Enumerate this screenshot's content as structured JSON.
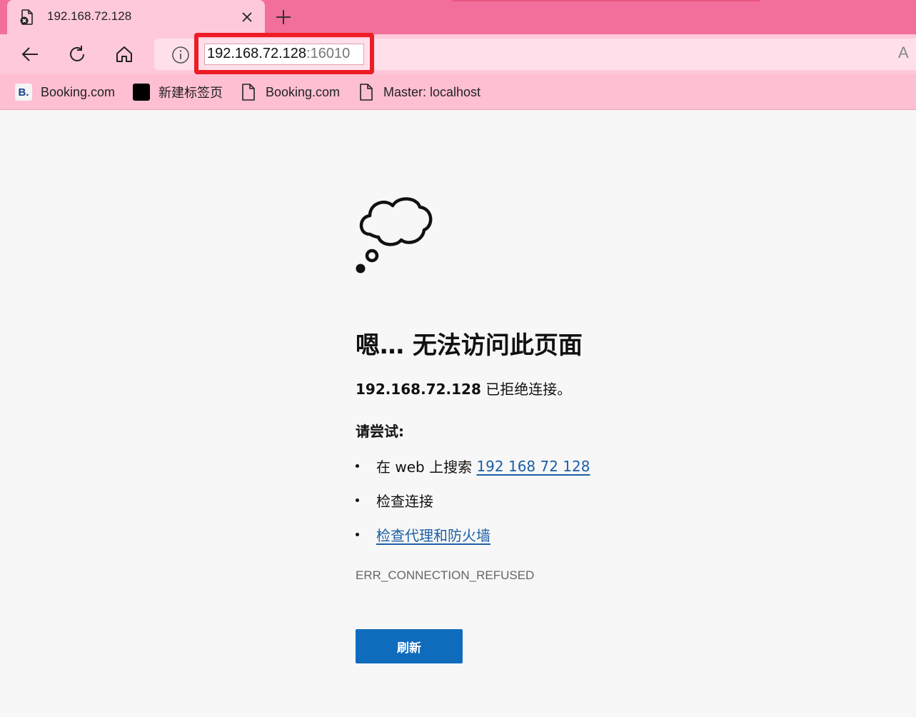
{
  "tab": {
    "title": "192.168.72.128",
    "favicon": "error-page-icon"
  },
  "toolbar": {
    "back_icon": "back-arrow-icon",
    "refresh_icon": "refresh-icon",
    "home_icon": "home-icon",
    "info_icon": "info-icon",
    "read_aloud_label": "A"
  },
  "address": {
    "host": "192.168.72.128",
    "port": ":16010"
  },
  "favorites": [
    {
      "label": "Booking.com",
      "icon": "booking-icon",
      "icon_text": "B."
    },
    {
      "label": "新建标签页",
      "icon": "black-square-icon"
    },
    {
      "label": "Booking.com",
      "icon": "page-icon"
    },
    {
      "label": "Master: localhost",
      "icon": "page-icon"
    }
  ],
  "error": {
    "title": "嗯… 无法访问此页面",
    "host": "192.168.72.128",
    "message": " 已拒绝连接。",
    "try_heading": "请尝试:",
    "suggestions": {
      "search_prefix": "在 web 上搜索 ",
      "search_link": "192 168 72 128",
      "check_connection": "检查连接",
      "check_proxy": "检查代理和防火墙"
    },
    "code": "ERR_CONNECTION_REFUSED",
    "refresh_label": "刷新"
  },
  "colors": {
    "tabstrip": "#f16f9a",
    "toolbar": "#ffc9dc",
    "highlight_box": "#ee1c25",
    "link": "#1b5fa6",
    "button": "#0f6cbd"
  }
}
